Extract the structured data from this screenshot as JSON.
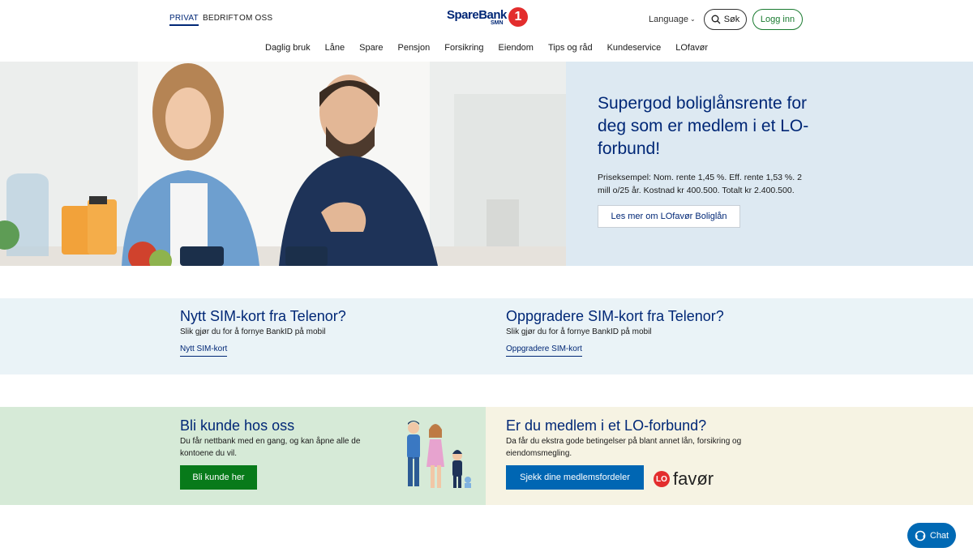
{
  "segments": {
    "privat": "PRIVAT",
    "bedrift": "BEDRIFT",
    "om_oss": "OM OSS"
  },
  "logo": {
    "brand": "SpareBank",
    "region": "SMN",
    "number": "1"
  },
  "header": {
    "language": "Language",
    "search": "Søk",
    "login": "Logg inn"
  },
  "nav": [
    "Daglig bruk",
    "Låne",
    "Spare",
    "Pensjon",
    "Forsikring",
    "Eiendom",
    "Tips og råd",
    "Kundeservice",
    "LOfavør"
  ],
  "hero": {
    "title": "Supergod boliglånsrente for deg som er medlem i et LO-forbund!",
    "body": "Priseksempel: Nom. rente 1,45 %. Eff. rente 1,53 %. 2 mill o/25 år. Kostnad kr 400.500. Totalt kr 2.400.500.",
    "button": "Les mer om LOfavør Boliglån"
  },
  "sim": [
    {
      "title": "Nytt SIM-kort fra Telenor?",
      "subtitle": "Slik gjør du for å fornye BankID på mobil",
      "link": "Nytt SIM-kort"
    },
    {
      "title": "Oppgradere SIM-kort fra Telenor?",
      "subtitle": "Slik gjør du for å fornye BankID på mobil",
      "link": "Oppgradere SIM-kort"
    }
  ],
  "customer": {
    "title": "Bli kunde hos oss",
    "body": "Du får nettbank med en gang, og kan åpne alle de kontoene du vil.",
    "button": "Bli kunde her"
  },
  "member": {
    "title": "Er du medlem i et LO-forbund?",
    "body": "Da får du ekstra gode betingelser på blant annet lån, forsikring og eiendomsmegling.",
    "button": "Sjekk dine medlemsfordeler",
    "logo_badge": "LO",
    "logo_text": "favør"
  },
  "chat": {
    "label": "Chat"
  },
  "colors": {
    "brand_blue": "#002776",
    "green": "#087a1a",
    "button_blue": "#0066b3",
    "chat_blue": "#0069b4",
    "lo_red": "#e32d2d"
  }
}
